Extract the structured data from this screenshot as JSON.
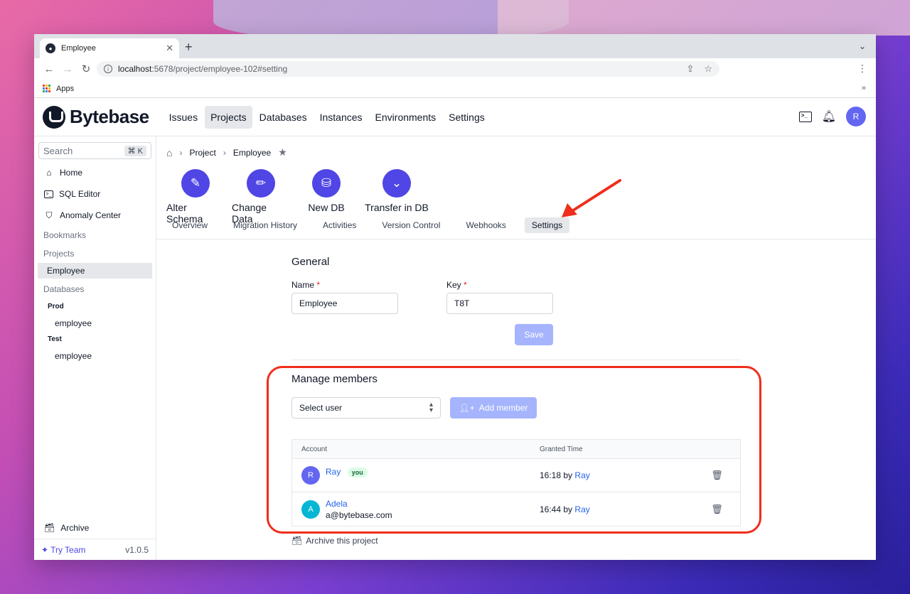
{
  "browser": {
    "tab_title": "Employee",
    "url_host": "localhost",
    "url_path": ":5678/project/employee-102#setting",
    "bookmark_apps": "Apps",
    "bookmark_more": "»"
  },
  "header": {
    "brand": "Bytebase",
    "nav": [
      "Issues",
      "Projects",
      "Databases",
      "Instances",
      "Environments",
      "Settings"
    ],
    "active_nav": "Projects",
    "avatar_initial": "R"
  },
  "sidebar": {
    "search_placeholder": "Search",
    "search_shortcut": "⌘ K",
    "items": [
      {
        "label": "Home",
        "icon": "home-icon"
      },
      {
        "label": "SQL Editor",
        "icon": "terminal-icon"
      },
      {
        "label": "Anomaly Center",
        "icon": "shield-icon"
      }
    ],
    "bookmarks_label": "Bookmarks",
    "projects_label": "Projects",
    "active_project": "Employee",
    "databases_label": "Databases",
    "env_prod": "Prod",
    "db_prod": "employee",
    "env_test": "Test",
    "db_test": "employee",
    "archive": "Archive",
    "try_team": "Try Team",
    "version": "v1.0.5"
  },
  "breadcrumb": {
    "project": "Project",
    "current": "Employee"
  },
  "quick_actions": [
    "Alter Schema",
    "Change Data",
    "New DB",
    "Transfer in DB"
  ],
  "tabs": [
    "Overview",
    "Migration History",
    "Activities",
    "Version Control",
    "Webhooks",
    "Settings"
  ],
  "active_tab": "Settings",
  "general": {
    "title": "General",
    "name_label": "Name",
    "name_value": "Employee",
    "key_label": "Key",
    "key_value": "T8T",
    "required_mark": "*",
    "save_label": "Save"
  },
  "members": {
    "title": "Manage members",
    "select_placeholder": "Select user",
    "add_label": "Add member",
    "col_account": "Account",
    "col_granted": "Granted Time",
    "rows": [
      {
        "initial": "R",
        "name": "Ray",
        "badge": "you",
        "email": "",
        "time": "16:18",
        "by_word": "by",
        "by": "Ray",
        "avatar_color": "#6366f1"
      },
      {
        "initial": "A",
        "name": "Adela",
        "badge": "",
        "email": "a@bytebase.com",
        "time": "16:44",
        "by_word": "by",
        "by": "Ray",
        "avatar_color": "#06b6d4"
      }
    ],
    "archive_label": "Archive this project"
  },
  "colors": {
    "accent": "#4f46e5",
    "accent_disabled": "#a5b4fc",
    "annotation": "#ef2e1c"
  }
}
